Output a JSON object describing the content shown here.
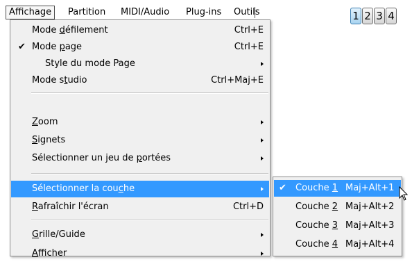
{
  "menubar": {
    "items": [
      "Affichage",
      "Partition",
      "MIDI/Audio",
      "Plug-ins",
      "Outils"
    ]
  },
  "dropdown": {
    "mode_defilement": {
      "pre": "Mode ",
      "ul": "d",
      "post": "éfilement",
      "shortcut": "Ctrl+E"
    },
    "mode_page": {
      "pre": "Mode ",
      "ul": "p",
      "post": "age",
      "shortcut": "Ctrl+E",
      "check": "✔"
    },
    "style_mode_page": {
      "label": "Style du mode Page"
    },
    "mode_studio": {
      "pre": "Mode s",
      "ul": "t",
      "post": "udio",
      "shortcut": "Ctrl+Maj+E"
    },
    "zoom": {
      "ul": "Z",
      "post": "oom"
    },
    "signets": {
      "ul": "S",
      "post": "ignets"
    },
    "selectionner_jeu": {
      "pre": "Sélectionner un jeu de ",
      "ul": "p",
      "post": "ortées"
    },
    "selectionner_couche": {
      "pre": "Sélectionner la cou",
      "ul": "c",
      "post": "he"
    },
    "rafraichir": {
      "ul": "R",
      "post": "afraîchir l'écran",
      "shortcut": "Ctrl+D"
    },
    "grille": {
      "ul": "G",
      "post": "rille/Guide"
    },
    "afficher": {
      "ul": "A",
      "post": "fficher"
    }
  },
  "submenu": {
    "items": [
      {
        "pre": "Couche ",
        "ul": "1",
        "shortcut": "Maj+Alt+1",
        "check": "✔"
      },
      {
        "pre": "Couche ",
        "ul": "2",
        "shortcut": "Maj+Alt+2"
      },
      {
        "pre": "Couche ",
        "ul": "3",
        "shortcut": "Maj+Alt+3"
      },
      {
        "pre": "Couche ",
        "ul": "4",
        "shortcut": "Maj+Alt+4"
      }
    ]
  },
  "layer_buttons": [
    "1",
    "2",
    "3",
    "4"
  ],
  "colors": {
    "highlight": "#3399ff",
    "menu_bg": "#f0f0f0",
    "layer_active": "#a9d4f0"
  }
}
